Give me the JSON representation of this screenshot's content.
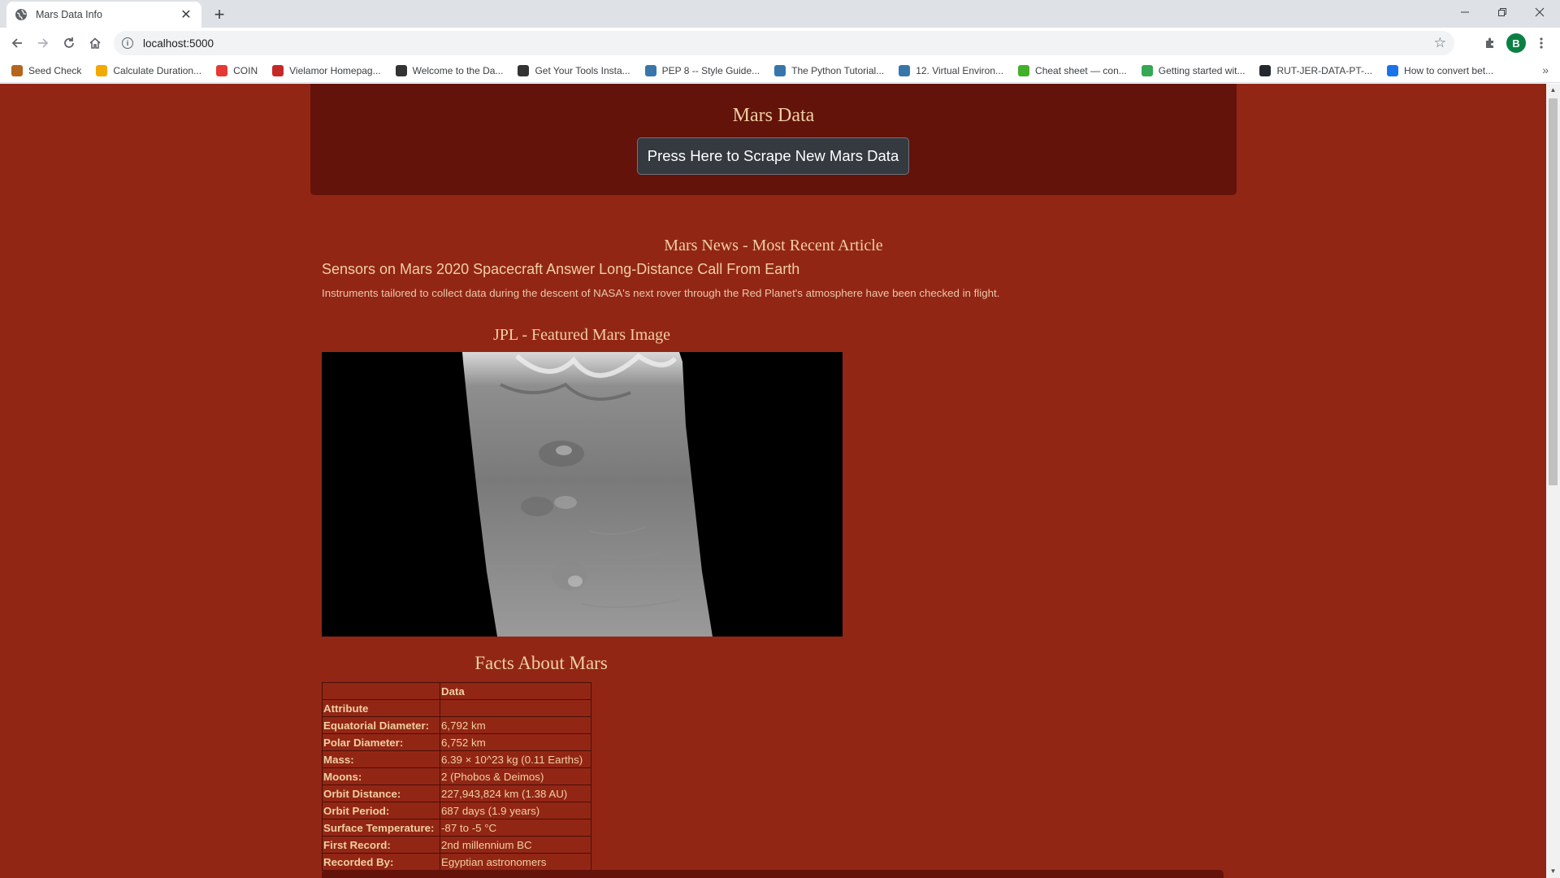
{
  "browser": {
    "tab_title": "Mars Data Info",
    "url": "localhost:5000",
    "profile_initial": "B",
    "bookmarks": [
      {
        "label": "Seed Check",
        "color": "#b5651d"
      },
      {
        "label": "Calculate Duration...",
        "color": "#f2a900"
      },
      {
        "label": "COIN",
        "color": "#e53935"
      },
      {
        "label": "Vielamor Homepag...",
        "color": "#c62828"
      },
      {
        "label": "Welcome to the Da...",
        "color": "#333333"
      },
      {
        "label": "Get Your Tools Insta...",
        "color": "#333333"
      },
      {
        "label": "PEP 8 -- Style Guide...",
        "color": "#3776ab"
      },
      {
        "label": "The Python Tutorial...",
        "color": "#3776ab"
      },
      {
        "label": "12. Virtual Environ...",
        "color": "#3776ab"
      },
      {
        "label": "Cheat sheet — con...",
        "color": "#43b02a"
      },
      {
        "label": "Getting started wit...",
        "color": "#34a853"
      },
      {
        "label": "RUT-JER-DATA-PT-...",
        "color": "#24292e"
      },
      {
        "label": "How to convert bet...",
        "color": "#1a73e8"
      }
    ]
  },
  "page": {
    "title": "Mars Data",
    "scrape_button": "Press Here to Scrape New Mars Data",
    "news_heading": "Mars News - Most Recent Article",
    "news_title": "Sensors on Mars 2020 Spacecraft Answer Long-Distance Call From Earth",
    "news_teaser": "Instruments tailored to collect data during the descent of NASA's next rover through the Red Planet's atmosphere have been checked in flight.",
    "image_heading": "JPL - Featured Mars Image",
    "facts_heading": "Facts About Mars",
    "facts": {
      "column_header": "Data",
      "index_label": "Attribute",
      "rows": [
        {
          "attr": "Equatorial Diameter:",
          "value": "6,792 km"
        },
        {
          "attr": "Polar Diameter:",
          "value": "6,752 km"
        },
        {
          "attr": "Mass:",
          "value": "6.39 × 10^23 kg (0.11 Earths)"
        },
        {
          "attr": "Moons:",
          "value": "2 (Phobos & Deimos)"
        },
        {
          "attr": "Orbit Distance:",
          "value": "227,943,824 km (1.38 AU)"
        },
        {
          "attr": "Orbit Period:",
          "value": "687 days (1.9 years)"
        },
        {
          "attr": "Surface Temperature:",
          "value": "-87 to -5 °C"
        },
        {
          "attr": "First Record:",
          "value": "2nd millennium BC"
        },
        {
          "attr": "Recorded By:",
          "value": "Egyptian astronomers"
        }
      ]
    }
  }
}
